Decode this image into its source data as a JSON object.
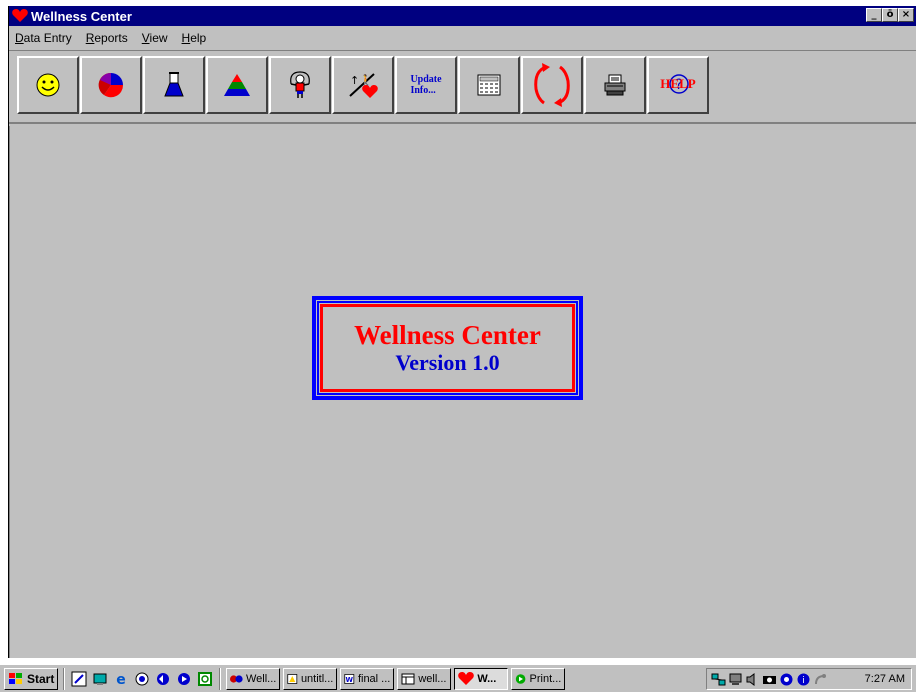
{
  "window": {
    "title": "Wellness Center",
    "buttons": {
      "minimize": "_",
      "maximize": "ō",
      "close": "×"
    }
  },
  "menu": [
    {
      "label": "Data Entry",
      "accel": "D"
    },
    {
      "label": "Reports",
      "accel": "R"
    },
    {
      "label": "View",
      "accel": "V"
    },
    {
      "label": "Help",
      "accel": "H"
    }
  ],
  "toolbar": {
    "buttons": [
      {
        "icon": "smiley-icon"
      },
      {
        "icon": "pie-chart-icon"
      },
      {
        "icon": "flask-icon"
      },
      {
        "icon": "food-pyramid-icon"
      },
      {
        "icon": "jump-rope-person-icon"
      },
      {
        "icon": "fitness-heart-icon"
      },
      {
        "icon": "update-info-icon",
        "label_line1": "Update",
        "label_line2": "Info..."
      },
      {
        "icon": "calculator-icon"
      },
      {
        "icon": "refresh-arrows-icon"
      },
      {
        "icon": "printer-icon"
      },
      {
        "icon": "help-icon"
      }
    ]
  },
  "splash": {
    "title": "Wellness Center",
    "version": "Version 1.0"
  },
  "taskbar": {
    "start_label": "Start",
    "tasks": [
      {
        "label": "Well...",
        "icon": "butterfly-icon",
        "active": false
      },
      {
        "label": "untitl...",
        "icon": "paint-icon",
        "active": false
      },
      {
        "label": "final ...",
        "icon": "word-doc-icon",
        "active": false
      },
      {
        "label": "well...",
        "icon": "access-db-icon",
        "active": false
      },
      {
        "label": "W...",
        "icon": "heart-icon",
        "active": true
      },
      {
        "label": "Print...",
        "icon": "print-queue-icon",
        "active": false
      }
    ],
    "clock": "7:27 AM"
  },
  "colors": {
    "title_bar": "#000080",
    "splash_title": "#ff0000",
    "splash_version": "#0000cc",
    "window_bg": "#c0c0c0"
  }
}
